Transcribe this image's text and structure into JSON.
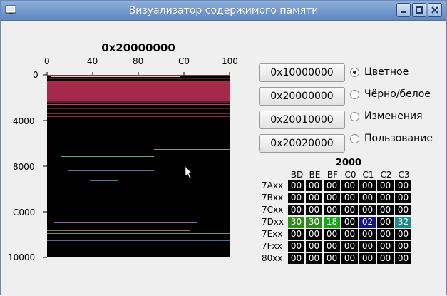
{
  "window": {
    "title": "Визуализатор содержимого памяти"
  },
  "map": {
    "title": "0x20000000",
    "x_ticks": [
      "0",
      "40",
      "80",
      "C0",
      "100"
    ],
    "y_ticks": [
      "0",
      "4000",
      "8000",
      "C000",
      "10000"
    ]
  },
  "address_buttons": [
    "0x10000000",
    "0x20000000",
    "0x20010000",
    "0x20020000"
  ],
  "modes": [
    {
      "label": "Цветное",
      "checked": true
    },
    {
      "label": "Чёрно/белое",
      "checked": false
    },
    {
      "label": "Изменения",
      "checked": false
    },
    {
      "label": "Пользование",
      "checked": false
    }
  ],
  "hex": {
    "title": "2000",
    "columns": [
      "BD",
      "BE",
      "BF",
      "C0",
      "C1",
      "C2",
      "C3"
    ],
    "rows": [
      {
        "label": "7Axx",
        "cells": [
          "00",
          "00",
          "00",
          "00",
          "00",
          "00",
          "00"
        ]
      },
      {
        "label": "7Bxx",
        "cells": [
          "00",
          "00",
          "00",
          "00",
          "00",
          "00",
          "00"
        ]
      },
      {
        "label": "7Cxx",
        "cells": [
          "00",
          "00",
          "00",
          "00",
          "00",
          "00",
          "00"
        ]
      },
      {
        "label": "7Dxx",
        "cells": [
          "30",
          "30",
          "18",
          "00",
          "02",
          "00",
          "32"
        ]
      },
      {
        "label": "7Exx",
        "cells": [
          "00",
          "00",
          "00",
          "00",
          "00",
          "00",
          "00"
        ]
      },
      {
        "label": "7Fxx",
        "cells": [
          "00",
          "00",
          "00",
          "00",
          "00",
          "00",
          "00"
        ]
      },
      {
        "label": "80xx",
        "cells": [
          "00",
          "00",
          "00",
          "00",
          "00",
          "00",
          "00"
        ]
      }
    ],
    "colors": {
      "30": "#2e8b1a",
      "18": "#15a515",
      "02": "#14148a",
      "32": "#1b8a8a",
      "00": "#000000"
    }
  }
}
